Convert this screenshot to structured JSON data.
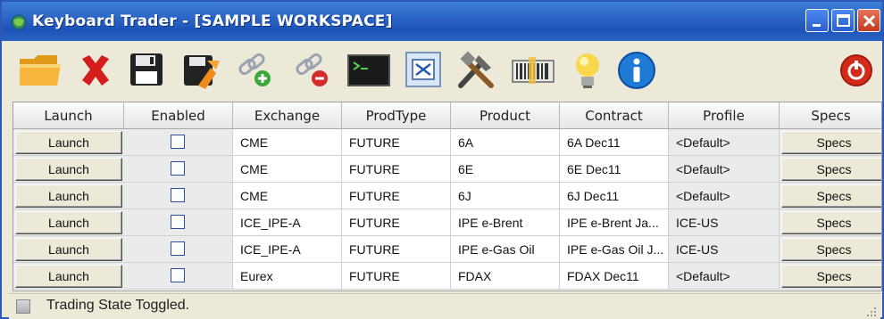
{
  "window": {
    "title": "Keyboard Trader - [SAMPLE WORKSPACE]"
  },
  "toolbar": {
    "items": [
      {
        "icon": "open-folder-icon"
      },
      {
        "icon": "delete-x-icon"
      },
      {
        "icon": "save-icon"
      },
      {
        "icon": "save-as-icon"
      },
      {
        "icon": "link-add-icon"
      },
      {
        "icon": "link-remove-icon"
      },
      {
        "icon": "terminal-icon"
      },
      {
        "icon": "shuffle-icon"
      },
      {
        "icon": "tools-icon"
      },
      {
        "icon": "keyboard-icon"
      },
      {
        "icon": "lightbulb-icon"
      },
      {
        "icon": "info-icon"
      },
      {
        "icon": "power-icon"
      }
    ]
  },
  "grid": {
    "columns": [
      "Launch",
      "Enabled",
      "Exchange",
      "ProdType",
      "Product",
      "Contract",
      "Profile",
      "Specs"
    ],
    "rows": [
      {
        "launch": "Launch",
        "exchange": "CME",
        "prodtype": "FUTURE",
        "product": "6A",
        "contract": "6A Dec11",
        "profile": "<Default>",
        "specs": "Specs"
      },
      {
        "launch": "Launch",
        "exchange": "CME",
        "prodtype": "FUTURE",
        "product": "6E",
        "contract": "6E Dec11",
        "profile": "<Default>",
        "specs": "Specs"
      },
      {
        "launch": "Launch",
        "exchange": "CME",
        "prodtype": "FUTURE",
        "product": "6J",
        "contract": "6J Dec11",
        "profile": "<Default>",
        "specs": "Specs"
      },
      {
        "launch": "Launch",
        "exchange": "ICE_IPE-A",
        "prodtype": "FUTURE",
        "product": "IPE e-Brent",
        "contract": "IPE e-Brent Ja...",
        "profile": "ICE-US",
        "specs": "Specs"
      },
      {
        "launch": "Launch",
        "exchange": "ICE_IPE-A",
        "prodtype": "FUTURE",
        "product": "IPE e-Gas Oil",
        "contract": "IPE e-Gas Oil J...",
        "profile": "ICE-US",
        "specs": "Specs"
      },
      {
        "launch": "Launch",
        "exchange": "Eurex",
        "prodtype": "FUTURE",
        "product": "FDAX",
        "contract": "FDAX Dec11",
        "profile": "<Default>",
        "specs": "Specs"
      }
    ]
  },
  "status": {
    "text": "Trading State Toggled."
  }
}
